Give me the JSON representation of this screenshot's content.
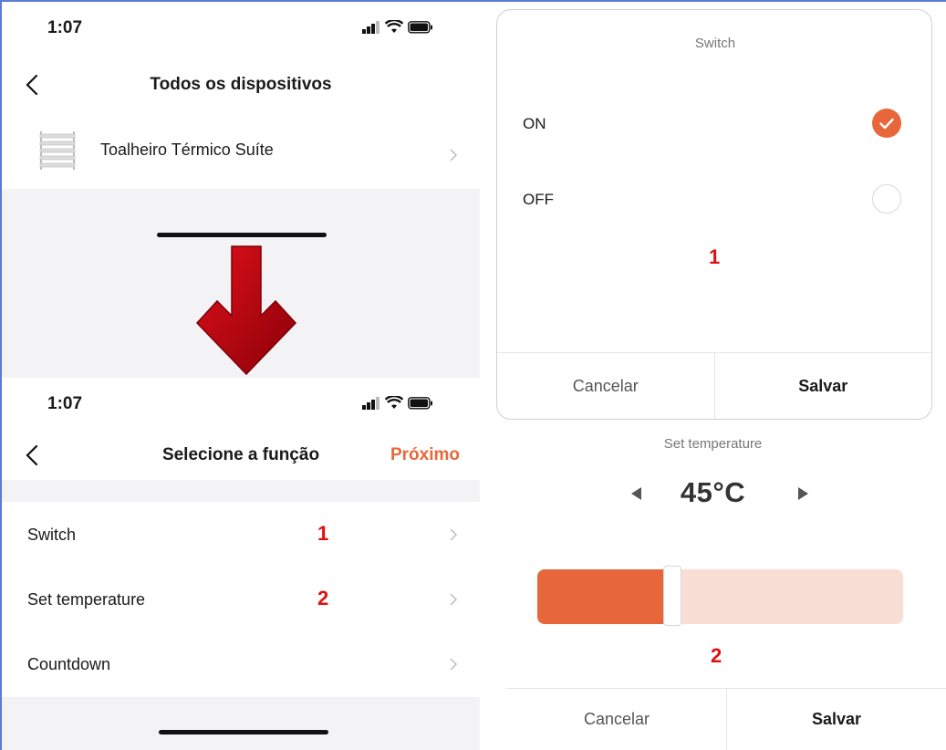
{
  "screen_top": {
    "time": "1:07",
    "title": "Todos os dispositivos",
    "device_name": "Toalheiro Térmico Suíte"
  },
  "screen_bottom": {
    "time": "1:07",
    "title": "Selecione a função",
    "next_label": "Próximo",
    "functions": [
      {
        "label": "Switch",
        "marker": "1"
      },
      {
        "label": "Set temperature",
        "marker": "2"
      },
      {
        "label": "Countdown",
        "marker": ""
      }
    ]
  },
  "switch_dialog": {
    "title": "Switch",
    "options": [
      {
        "label": "ON",
        "selected": true
      },
      {
        "label": "OFF",
        "selected": false
      }
    ],
    "marker": "1",
    "cancel_label": "Cancelar",
    "save_label": "Salvar"
  },
  "temp_dialog": {
    "title": "Set temperature",
    "value": "45°C",
    "slider_fraction": 0.37,
    "marker": "2",
    "cancel_label": "Cancelar",
    "save_label": "Salvar"
  },
  "colors": {
    "accent": "#e8673a",
    "accent_light": "#f8ded5",
    "marker_red": "#e01010",
    "arrow_red": "#c0000a"
  }
}
